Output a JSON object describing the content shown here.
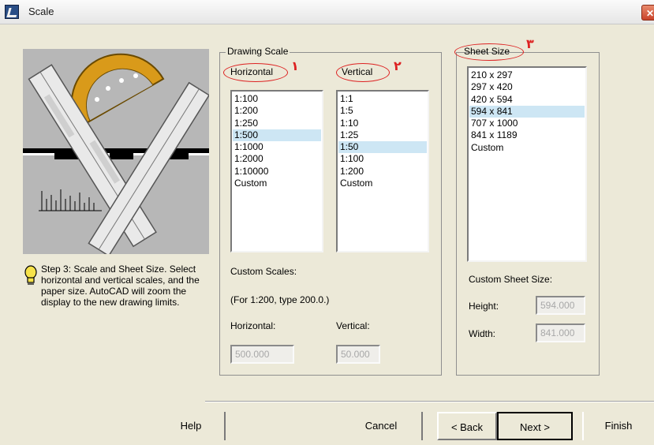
{
  "window": {
    "title": "Scale",
    "close_label": "✕"
  },
  "hint": {
    "text": "Step 3: Scale and Sheet Size. Select horizontal and vertical scales, and the paper size. AutoCAD will zoom the display to the new drawing limits."
  },
  "drawing_scale": {
    "title": "Drawing Scale",
    "horizontal": {
      "header": "Horizontal",
      "marker": "١",
      "items": [
        "1:100",
        "1:200",
        "1:250",
        "1:500",
        "1:1000",
        "1:2000",
        "1:10000",
        "Custom"
      ],
      "selected_index": 3
    },
    "vertical": {
      "header": "Vertical",
      "marker": "٢",
      "items": [
        "1:1",
        "1:5",
        "1:10",
        "1:25",
        "1:50",
        "1:100",
        "1:200",
        "Custom"
      ],
      "selected_index": 4
    },
    "custom_scales_label": "Custom Scales:",
    "example_text": "(For 1:200, type 200.0.)",
    "horizontal_label": "Horizontal:",
    "vertical_label": "Vertical:",
    "horizontal_value": "500.000",
    "vertical_value": "50.000"
  },
  "sheet_size": {
    "title": "Sheet Size",
    "marker": "٣",
    "items": [
      "210 x 297",
      "297 x 420",
      "420 x 594",
      "594 x 841",
      "707 x 1000",
      "841 x 1189",
      "Custom"
    ],
    "selected_index": 3,
    "custom_label": "Custom Sheet Size:",
    "height_label": "Height:",
    "width_label": "Width:",
    "height_value": "594.000",
    "width_value": "841.000"
  },
  "buttons": {
    "help": "Help",
    "cancel": "Cancel",
    "back": "< Back",
    "next": "Next >",
    "finish": "Finish"
  },
  "colors": {
    "selection": "#cde6f4",
    "annotation": "#dd2222",
    "dialog_bg": "#ece9d8"
  }
}
